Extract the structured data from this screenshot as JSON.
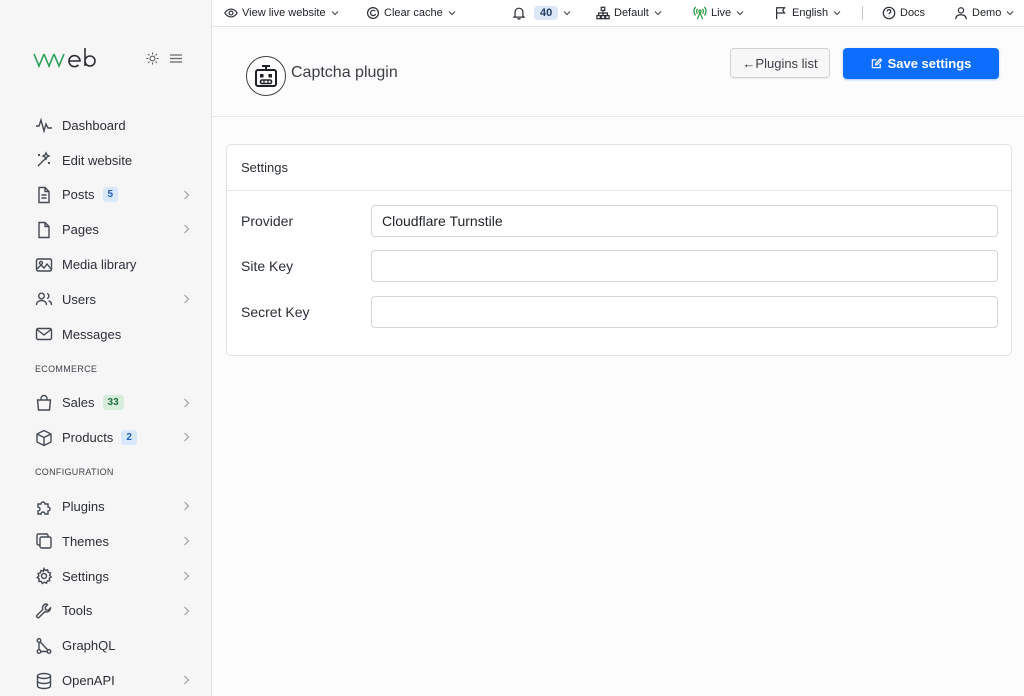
{
  "logo": {
    "text": "vvveb"
  },
  "sidebar": {
    "items": [
      {
        "label": "Dashboard",
        "icon": "pulse-icon"
      },
      {
        "label": "Edit website",
        "icon": "magic-wand-icon"
      },
      {
        "label": "Posts",
        "icon": "file-icon",
        "badge": "5",
        "badge_color": "blue",
        "chevron": true
      },
      {
        "label": "Pages",
        "icon": "page-icon",
        "chevron": true
      },
      {
        "label": "Media library",
        "icon": "image-icon"
      },
      {
        "label": "Users",
        "icon": "users-icon",
        "chevron": true
      },
      {
        "label": "Messages",
        "icon": "mail-icon"
      }
    ],
    "section_ecommerce": "ECOMMERCE",
    "ecommerce_items": [
      {
        "label": "Sales",
        "icon": "bag-icon",
        "badge": "33",
        "badge_color": "green",
        "chevron": true
      },
      {
        "label": "Products",
        "icon": "box-icon",
        "badge": "2",
        "badge_color": "blue",
        "chevron": true
      }
    ],
    "section_configuration": "CONFIGURATION",
    "config_items": [
      {
        "label": "Plugins",
        "icon": "puzzle-icon",
        "chevron": true
      },
      {
        "label": "Themes",
        "icon": "copy-icon",
        "chevron": true
      },
      {
        "label": "Settings",
        "icon": "gear-icon",
        "chevron": true
      },
      {
        "label": "Tools",
        "icon": "wrench-icon",
        "chevron": true
      },
      {
        "label": "GraphQL",
        "icon": "graph-icon"
      },
      {
        "label": "OpenAPI",
        "icon": "database-icon",
        "chevron": true
      }
    ]
  },
  "topbar": {
    "view_live": "View live website",
    "clear_cache": "Clear cache",
    "notifications_count": "40",
    "site": "Default",
    "status": "Live",
    "language": "English",
    "docs": "Docs",
    "user": "Demo"
  },
  "header": {
    "title": "Captcha plugin",
    "plugins_list": "←Plugins list",
    "save": "Save settings"
  },
  "settings": {
    "title": "Settings",
    "fields": [
      {
        "label": "Provider",
        "value": "Cloudflare Turnstile"
      },
      {
        "label": "Site Key",
        "value": ""
      },
      {
        "label": "Secret Key",
        "value": ""
      }
    ]
  },
  "colors": {
    "primary": "#0d6efd",
    "logo_accent": "#2c9f5a",
    "live_status": "#2a9d3f"
  }
}
